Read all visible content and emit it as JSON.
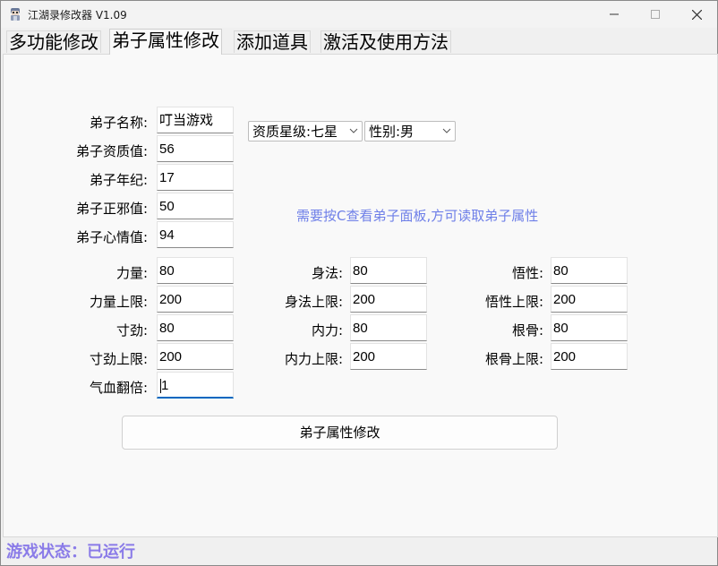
{
  "window": {
    "title": "江湖录修改器 V1.09",
    "app_icon": "character-sprite-icon",
    "controls": [
      "minimize-icon",
      "maximize-icon",
      "close-icon"
    ]
  },
  "tabs": [
    {
      "label": "多功能修改",
      "active": false
    },
    {
      "label": "弟子属性修改",
      "active": true
    },
    {
      "label": "添加道具",
      "active": false
    },
    {
      "label": "激活及使用方法",
      "active": false
    }
  ],
  "disciple": {
    "name": {
      "label": "弟子名称:",
      "value": "叮当游戏"
    },
    "aptitude": {
      "label": "弟子资质值:",
      "value": "56"
    },
    "age": {
      "label": "弟子年纪:",
      "value": "17"
    },
    "morality": {
      "label": "弟子正邪值:",
      "value": "50"
    },
    "mood": {
      "label": "弟子心情值:",
      "value": "94"
    }
  },
  "selects": {
    "quality": "资质星级:七星",
    "gender": "性别:男"
  },
  "hint": "需要按C查看弟子面板,方可读取弟子属性",
  "stats": {
    "strength": {
      "label": "力量:",
      "value": "80"
    },
    "strength_max": {
      "label": "力量上限:",
      "value": "200"
    },
    "cunjin": {
      "label": "寸劲:",
      "value": "80"
    },
    "cunjin_max": {
      "label": "寸劲上限:",
      "value": "200"
    },
    "hp_multiplier": {
      "label": "气血翻倍:",
      "value": "1"
    },
    "agility": {
      "label": "身法:",
      "value": "80"
    },
    "agility_max": {
      "label": "身法上限:",
      "value": "200"
    },
    "inner": {
      "label": "内力:",
      "value": "80"
    },
    "inner_max": {
      "label": "内力上限:",
      "value": "200"
    },
    "wisdom": {
      "label": "悟性:",
      "value": "80"
    },
    "wisdom_max": {
      "label": "悟性上限:",
      "value": "200"
    },
    "bone": {
      "label": "根骨:",
      "value": "80"
    },
    "bone_max": {
      "label": "根骨上限:",
      "value": "200"
    }
  },
  "apply_button": "弟子属性修改",
  "status": "游戏状态：已运行",
  "colors": {
    "hint": "#6e7fe8",
    "status": "#8a7be8",
    "focus_underline": "#0067c0"
  }
}
